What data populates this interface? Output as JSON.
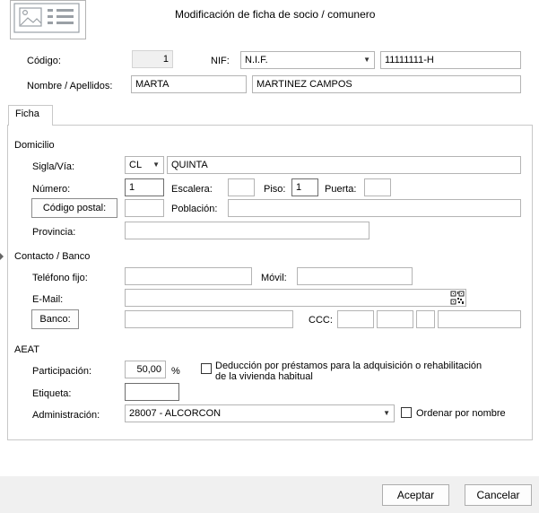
{
  "window": {
    "title": "Modificación de ficha de socio / comunero"
  },
  "header": {
    "codigo_label": "Código:",
    "codigo_value": "1",
    "nif_label": "NIF:",
    "nif_type": "N.I.F.",
    "nif_value": "11111111-H",
    "nombre_label": "Nombre / Apellidos:",
    "nombre_value": "MARTA",
    "apellidos_value": "MARTINEZ CAMPOS"
  },
  "tabs": [
    {
      "label": "Ficha"
    }
  ],
  "domicilio": {
    "title": "Domicilio",
    "sigla_label": "Sigla/Vía:",
    "sigla_value": "CL",
    "via_value": "QUINTA",
    "numero_label": "Número:",
    "numero_value": "1",
    "escalera_label": "Escalera:",
    "escalera_value": "",
    "piso_label": "Piso:",
    "piso_value": "1",
    "puerta_label": "Puerta:",
    "puerta_value": "",
    "codigo_postal_button": "Código postal:",
    "codigo_postal_value": "",
    "poblacion_label": "Población:",
    "poblacion_value": "",
    "provincia_label": "Provincia:",
    "provincia_value": ""
  },
  "contacto": {
    "title": "Contacto / Banco",
    "telefono_label": "Teléfono fijo:",
    "telefono_value": "",
    "movil_label": "Móvil:",
    "movil_value": "",
    "email_label": "E-Mail:",
    "email_value": "",
    "banco_button": "Banco:",
    "banco_value": "",
    "ccc_label": "CCC:",
    "ccc_values": [
      "",
      "",
      "",
      ""
    ]
  },
  "aeat": {
    "title": "AEAT",
    "participacion_label": "Participación:",
    "participacion_value": "50,00",
    "percent_sign": "%",
    "deduccion_label": "Deducción por préstamos para la adquisición o rehabilitación",
    "deduccion_label_2": "de la vivienda habitual",
    "deduccion_checked": false,
    "etiqueta_label": "Etiqueta:",
    "etiqueta_value": "",
    "administracion_label": "Administración:",
    "administracion_value": "28007 - ALCORCON",
    "ordenar_label": "Ordenar por nombre",
    "ordenar_checked": false
  },
  "footer": {
    "aceptar_label": "Aceptar",
    "cancelar_label": "Cancelar"
  },
  "icons": {
    "form_icon": "id-card-icon",
    "dropdown": "chevron-down-icon",
    "qr": "qr-code-icon"
  }
}
